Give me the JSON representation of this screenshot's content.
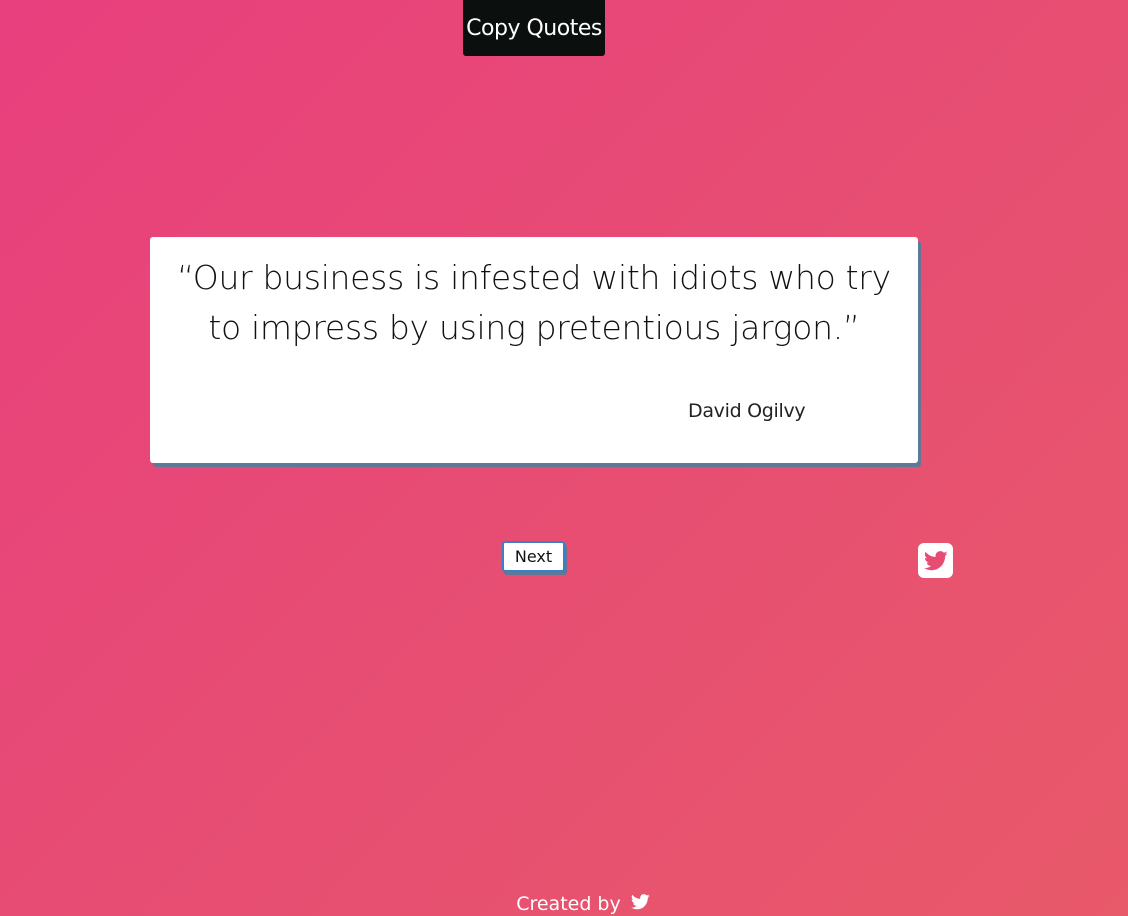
{
  "header": {
    "title": "Copy Quotes"
  },
  "quote": {
    "text": "“Our business is infested with idiots who try to impress by using pretentious jargon.”",
    "author": "David Ogilvy"
  },
  "controls": {
    "next_label": "Next",
    "tweet_icon": "twitter-square-icon"
  },
  "footer": {
    "created_by": "Created by",
    "icon": "twitter-bird-icon"
  },
  "colors": {
    "gradient_start": "#e83f7e",
    "gradient_end": "#e8596a",
    "badge_background": "#0b0f0d",
    "card_shadow": "#5e7896",
    "button_border": "#3d7fc6"
  }
}
